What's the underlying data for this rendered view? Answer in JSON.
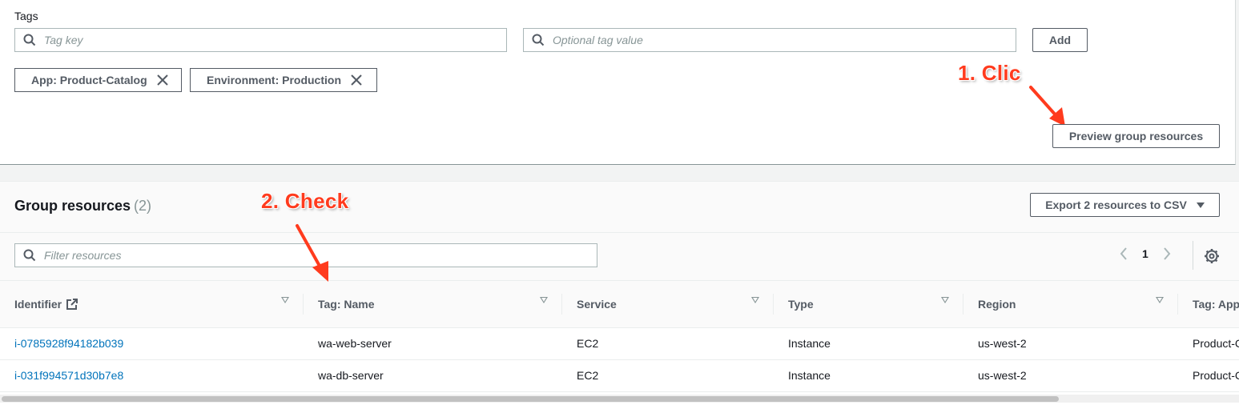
{
  "tags": {
    "label": "Tags",
    "key_placeholder": "Tag key",
    "value_placeholder": "Optional tag value",
    "add_label": "Add",
    "tokens": [
      "App: Product-Catalog",
      "Environment: Production"
    ],
    "preview_label": "Preview group resources"
  },
  "annotations": {
    "click": "1. Clic",
    "check": "2. Check",
    "color": "#ff3b1e"
  },
  "resources": {
    "title": "Group resources",
    "count": "(2)",
    "export_label": "Export 2 resources to CSV",
    "filter_placeholder": "Filter resources",
    "page": "1",
    "columns": [
      "Identifier",
      "Tag: Name",
      "Service",
      "Type",
      "Region",
      "Tag: App"
    ],
    "rows": [
      [
        "i-0785928f94182b039",
        "wa-web-server",
        "EC2",
        "Instance",
        "us-west-2",
        "Product-Catalog"
      ],
      [
        "i-031f994571d30b7e8",
        "wa-db-server",
        "EC2",
        "Instance",
        "us-west-2",
        "Product-Catalog"
      ]
    ],
    "link_color": "#0073bb"
  },
  "icons": {
    "search": "search-icon",
    "close": "close-icon",
    "external": "external-link-icon",
    "settings": "gear-icon",
    "prev": "chevron-left-icon",
    "next": "chevron-right-icon",
    "sort": "sort-caret-icon"
  }
}
